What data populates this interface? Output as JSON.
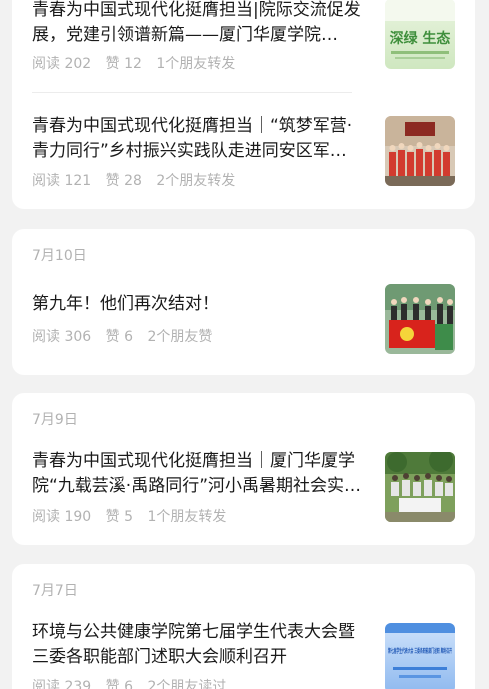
{
  "groups": [
    {
      "date": "",
      "articles": [
        {
          "title": "青春为中国式现代化挺膺担当|院际交流促发展，党建引领谱新篇——厦门华厦学院…",
          "reads": "阅读 202",
          "likes": "赞 12",
          "social": "1个朋友转发",
          "thumb_text": "深绿 生态"
        },
        {
          "title": "青春为中国式现代化挺膺担当｜“筑梦军营·青力同行”乡村振兴实践队走进同安区军…",
          "reads": "阅读 121",
          "likes": "赞 28",
          "social": "2个朋友转发"
        }
      ]
    },
    {
      "date": "7月10日",
      "articles": [
        {
          "title": "第九年！他们再次结对！",
          "reads": "阅读 306",
          "likes": "赞 6",
          "social": "2个朋友赞"
        }
      ]
    },
    {
      "date": "7月9日",
      "articles": [
        {
          "title": "青春为中国式现代化挺膺担当｜厦门华厦学院“九载芸溪·禹路同行”河小禹暑期社会实…",
          "reads": "阅读 190",
          "likes": "赞 5",
          "social": "1个朋友转发"
        }
      ]
    },
    {
      "date": "7月7日",
      "articles": [
        {
          "title": "环境与公共健康学院第七届学生代表大会暨三委各职能部门述职大会顺利召开",
          "reads": "阅读 239",
          "likes": "赞 6",
          "social": "2个朋友读过",
          "thumb_text": "第七届学生代表大会 三委各职能部门述职 顺利召开"
        }
      ]
    }
  ],
  "colors": {
    "background": "#f2f2f2",
    "card": "#ffffff",
    "title": "#1a1a1a",
    "meta": "#b2b2b2"
  }
}
